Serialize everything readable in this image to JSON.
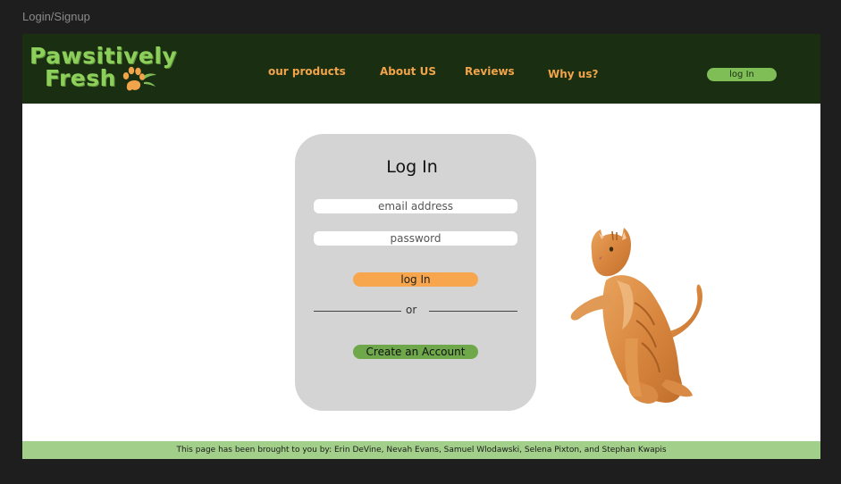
{
  "frame": {
    "label": "Login/Signup"
  },
  "brand": {
    "name_line1": "Pawsitively",
    "name_line2": "Fresh",
    "colors": {
      "nav_bg": "#1a2e12",
      "logo_green": "#8ccf5a",
      "accent_orange": "#f2a44a",
      "button_green": "#6ea84a",
      "footer_green": "#a2cf8a"
    }
  },
  "nav": {
    "links": [
      {
        "label": "our products"
      },
      {
        "label": "About US"
      },
      {
        "label": "Reviews"
      },
      {
        "label": "Why us?"
      }
    ],
    "login_label": "log In"
  },
  "login_card": {
    "title": "Log In",
    "email_placeholder": "email address",
    "password_placeholder": "password",
    "login_button": "log In",
    "divider_text": "or",
    "create_account_button": "Create an Account"
  },
  "hero_image": {
    "icon": "orange-tabby-cat-image"
  },
  "footer": {
    "text": "This page has been brought to you by: Erin DeVine, Nevah Evans, Samuel Wlodawski, Selena Pixton, and Stephan Kwapis"
  }
}
